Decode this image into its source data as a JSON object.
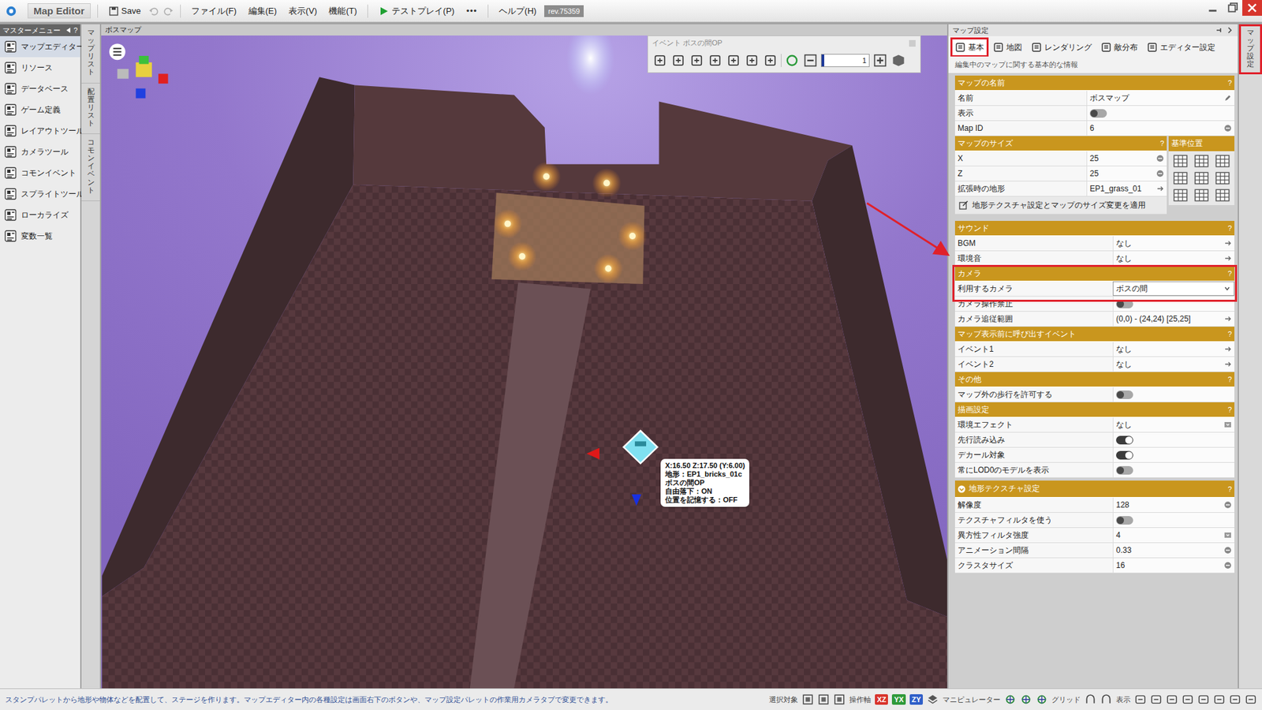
{
  "app": {
    "logo": "Map Editor",
    "save": "Save",
    "menus": [
      "ファイル(F)",
      "編集(E)",
      "表示(V)",
      "機能(T)"
    ],
    "testplay": "テストプレイ(P)",
    "more": "•••",
    "help": "ヘルプ(H)",
    "revision": "rev.75359"
  },
  "master_menu": {
    "title": "マスターメニュー",
    "help": "?",
    "items": [
      {
        "label": "マップエディター",
        "selected": true
      },
      {
        "label": "リソース",
        "selected": false
      },
      {
        "label": "データベース",
        "selected": false
      },
      {
        "label": "ゲーム定義",
        "selected": false
      },
      {
        "label": "レイアウトツール",
        "selected": false
      },
      {
        "label": "カメラツール",
        "selected": false
      },
      {
        "label": "コモンイベント",
        "selected": false
      },
      {
        "label": "スプライトツール",
        "selected": false
      },
      {
        "label": "ローカライズ",
        "selected": false
      },
      {
        "label": "変数一覧",
        "selected": false
      }
    ]
  },
  "side_tabs": [
    "マップリスト",
    "配置リスト",
    "コモンイベント"
  ],
  "viewport": {
    "title": "ボスマップ",
    "event_toolbar": {
      "title": "イベント ボスの間OP",
      "value": "1",
      "level": 0.06
    },
    "tooltip": [
      "X:16.50 Z:17.50 (Y:6.00)",
      "地形：EP1_bricks_01c",
      "ボスの間OP",
      "自由落下：ON",
      "位置を記憶する：OFF"
    ]
  },
  "map_settings": {
    "title": "マップ設定",
    "tabs": [
      {
        "label": "基本",
        "selected": true,
        "highlighted": true
      },
      {
        "label": "地図",
        "selected": false,
        "highlighted": false
      },
      {
        "label": "レンダリング",
        "selected": false,
        "highlighted": false
      },
      {
        "label": "敵分布",
        "selected": false,
        "highlighted": false
      },
      {
        "label": "エディター設定",
        "selected": false,
        "highlighted": false
      }
    ],
    "description": "編集中のマップに関する基本的な情報",
    "sections": [
      {
        "title": "マップの名前",
        "help": "?",
        "kind": "plain",
        "highlighted": false,
        "expanded": true,
        "rows": [
          {
            "label": "名前",
            "kind": "edit",
            "value": "ボスマップ"
          },
          {
            "label": "表示",
            "kind": "toggle",
            "on": false
          },
          {
            "label": "Map ID",
            "kind": "number",
            "value": "6"
          }
        ]
      },
      {
        "title": "マップのサイズ",
        "help": "?",
        "kind": "size",
        "highlighted": false,
        "expanded": true,
        "side_title": "基準位置",
        "rows": [
          {
            "label": "X",
            "kind": "number",
            "value": "25"
          },
          {
            "label": "Z",
            "kind": "number",
            "value": "25"
          },
          {
            "label": "拡張時の地形",
            "kind": "link",
            "value": "EP1_grass_01"
          },
          {
            "label": "地形テクスチャ設定とマップのサイズ変更を適用",
            "kind": "button"
          }
        ]
      },
      {
        "title": "サウンド",
        "help": "?",
        "kind": "plain",
        "highlighted": false,
        "expanded": true,
        "rows": [
          {
            "label": "BGM",
            "kind": "link",
            "value": "なし"
          },
          {
            "label": "環境音",
            "kind": "link",
            "value": "なし"
          }
        ]
      },
      {
        "title": "カメラ",
        "help": "?",
        "kind": "plain",
        "highlighted": true,
        "expanded": true,
        "rows": [
          {
            "label": "利用するカメラ",
            "kind": "dropdown",
            "value": "ボスの間"
          },
          {
            "label": "カメラ操作禁止",
            "kind": "toggle",
            "on": false
          },
          {
            "label": "カメラ追従範囲",
            "kind": "link",
            "value": "(0,0) - (24,24) [25,25]"
          }
        ]
      },
      {
        "title": "マップ表示前に呼び出すイベント",
        "help": "?",
        "kind": "plain",
        "highlighted": false,
        "expanded": true,
        "rows": [
          {
            "label": "イベント1",
            "kind": "link",
            "value": "なし"
          },
          {
            "label": "イベント2",
            "kind": "link",
            "value": "なし"
          }
        ]
      },
      {
        "title": "その他",
        "help": "?",
        "kind": "plain",
        "highlighted": false,
        "expanded": true,
        "rows": [
          {
            "label": "マップ外の歩行を許可する",
            "kind": "toggle",
            "on": false
          }
        ]
      },
      {
        "title": "描画設定",
        "help": "?",
        "kind": "plain",
        "highlighted": false,
        "expanded": true,
        "rows": [
          {
            "label": "環境エフェクト",
            "kind": "select",
            "value": "なし"
          },
          {
            "label": "先行読み込み",
            "kind": "toggle",
            "on": true
          },
          {
            "label": "デカール対象",
            "kind": "toggle",
            "on": true
          },
          {
            "label": "常にLOD0のモデルを表示",
            "kind": "toggle",
            "on": false
          }
        ]
      },
      {
        "title": "地形テクスチャ設定",
        "help": "?",
        "kind": "collapsible",
        "highlighted": false,
        "expanded": true,
        "rows": [
          {
            "label": "解像度",
            "kind": "number",
            "value": "128"
          },
          {
            "label": "テクスチャフィルタを使う",
            "kind": "toggle",
            "on": false
          },
          {
            "label": "異方性フィルタ強度",
            "kind": "select",
            "value": "4"
          },
          {
            "label": "アニメーション間隔",
            "kind": "number",
            "value": "0.33"
          },
          {
            "label": "クラスタサイズ",
            "kind": "number",
            "value": "16"
          }
        ]
      }
    ]
  },
  "right_strip": {
    "label": "マップ設定",
    "highlighted": true
  },
  "status_bar": {
    "message": "スタンプパレットから地形や物体などを配置して、ステージを作ります。マップエディター内の各種設定は画面右下のボタンや、マップ設定パレットの作業用カメラタブで変更できます。",
    "selection_label": "選択対象",
    "axis_label": "操作軸",
    "axes": [
      {
        "label": "XZ",
        "color": "#d8342c"
      },
      {
        "label": "YX",
        "color": "#2f9a3a"
      },
      {
        "label": "ZY",
        "color": "#2f5fc8"
      }
    ],
    "manipulator": "マニピュレーター",
    "grid": "グリッド",
    "display": "表示"
  }
}
